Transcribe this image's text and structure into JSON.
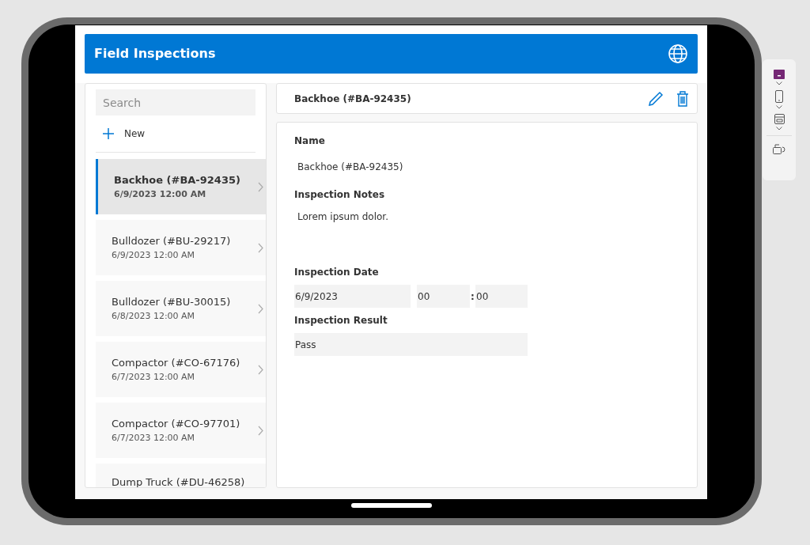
{
  "app_bar": {
    "title": "Field Inspections"
  },
  "search": {
    "placeholder": "Search"
  },
  "new_button": {
    "label": "New"
  },
  "list": [
    {
      "title": "Backhoe (#BA-92435)",
      "subtitle": "6/9/2023 12:00 AM",
      "selected": true
    },
    {
      "title": "Bulldozer (#BU-29217)",
      "subtitle": "6/9/2023 12:00 AM",
      "selected": false
    },
    {
      "title": "Bulldozer (#BU-30015)",
      "subtitle": "6/8/2023 12:00 AM",
      "selected": false
    },
    {
      "title": "Compactor (#CO-67176)",
      "subtitle": "6/7/2023 12:00 AM",
      "selected": false
    },
    {
      "title": "Compactor (#CO-97701)",
      "subtitle": "6/7/2023 12:00 AM",
      "selected": false
    },
    {
      "title": "Dump Truck (#DU-46258)",
      "selected": false
    }
  ],
  "detail": {
    "title": "Backhoe (#BA-92435)",
    "name_label": "Name",
    "name_value": "Backhoe (#BA-92435)",
    "notes_label": "Inspection Notes",
    "notes_value": "Lorem ipsum dolor.",
    "date_label": "Inspection Date",
    "date_value": "6/9/2023",
    "hour": "00",
    "separator": ":",
    "minute": "00",
    "result_label": "Inspection Result",
    "result_value": "Pass"
  }
}
